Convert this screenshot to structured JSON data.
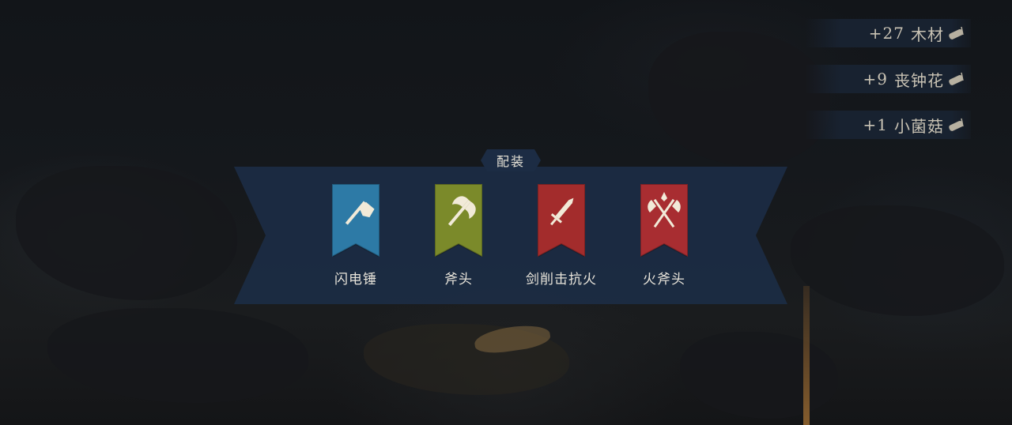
{
  "toasts": [
    {
      "amount": "+27",
      "item": "木材",
      "icon": "wood-log-icon"
    },
    {
      "amount": "+9",
      "item": "丧钟花",
      "icon": "wood-log-icon"
    },
    {
      "amount": "+1",
      "item": "小菌菇",
      "icon": "wood-log-icon"
    }
  ],
  "loadout": {
    "title": "配装",
    "slots": [
      {
        "label": "闪电锤",
        "icon": "hammer-icon",
        "color": "#2d7aa6"
      },
      {
        "label": "斧头",
        "icon": "axe-icon",
        "color": "#7b8a2a"
      },
      {
        "label": "剑削击抗火",
        "icon": "sword-icon",
        "color": "#a32c2c"
      },
      {
        "label": "火斧头",
        "icon": "crossed-axes-icon",
        "color": "#a82d31"
      }
    ]
  },
  "colors": {
    "panel": "#1c2c44",
    "text": "#e8e4da",
    "toast_text": "#c9c3b4",
    "banner_emblem": "#f1ead8"
  }
}
